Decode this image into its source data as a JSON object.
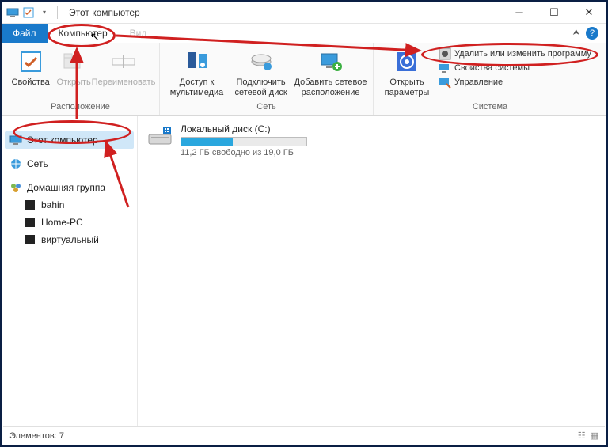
{
  "title": "Этот компьютер",
  "tabs": {
    "file": "Файл",
    "computer": "Компьютер",
    "view": "Вид"
  },
  "ribbon": {
    "group1": {
      "label": "Расположение",
      "props": "Свойства",
      "open": "Открыть",
      "rename": "Переименовать"
    },
    "group2": {
      "label": "Сеть",
      "media": "Доступ к мультимедиа",
      "mapdrive": "Подключить сетевой диск",
      "addloc": "Добавить сетевое расположение"
    },
    "group3": {
      "label": "Система",
      "settings": "Открыть параметры",
      "uninstall": "Удалить или изменить программу",
      "sysprops": "Свойства системы",
      "manage": "Управление"
    }
  },
  "nav": {
    "thispc": "Этот компьютер",
    "network": "Сеть",
    "homegroup": "Домашняя группа",
    "items": [
      "bahin",
      "Home-PC",
      "виртуальный"
    ]
  },
  "drive": {
    "name": "Локальный диск (C:)",
    "free": "11,2 ГБ свободно из 19,0 ГБ",
    "fill_pct": 41
  },
  "status": "Элементов: 7"
}
